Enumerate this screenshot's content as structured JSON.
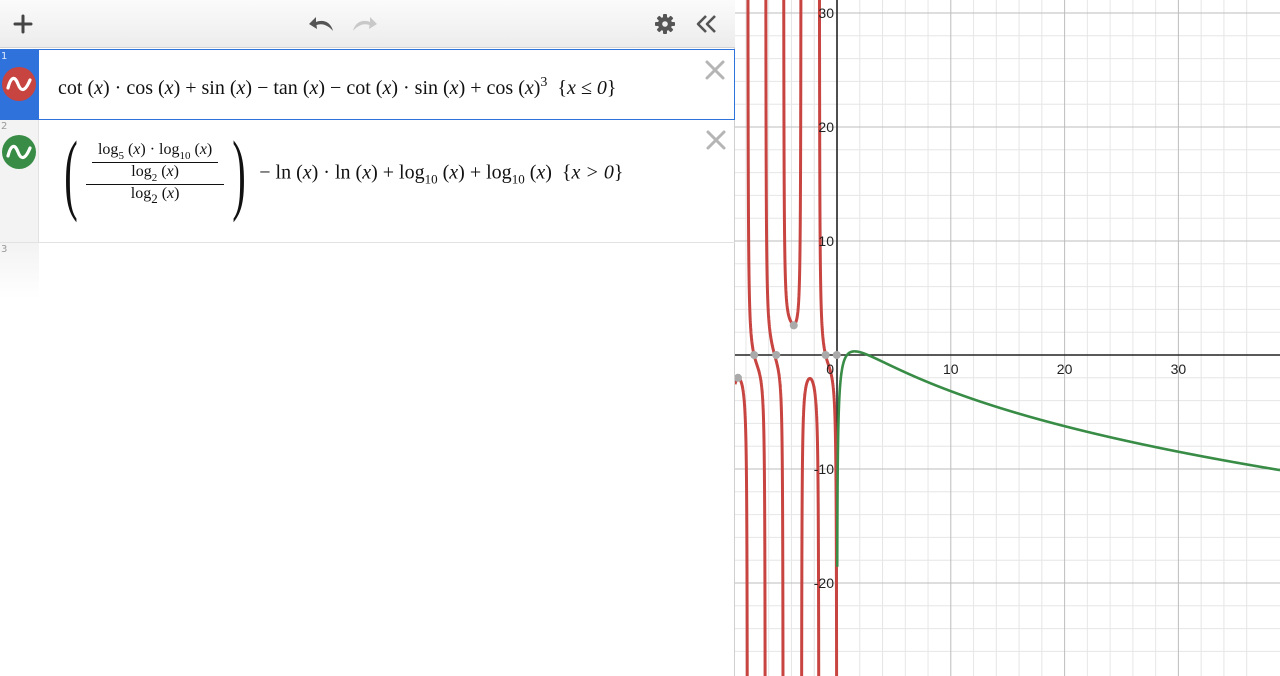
{
  "toolbar": {
    "add_icon": "plus-icon",
    "undo_icon": "undo-icon",
    "redo_icon": "redo-icon",
    "settings_icon": "gear-icon",
    "collapse_icon": "double-chevron-left-icon"
  },
  "expressions": [
    {
      "number": "1",
      "color": "#c74440",
      "selected": true,
      "latex_text": "cot (x) · cos (x) + sin (x) − tan (x) − cot (x) · sin (x) + cos (x)^3 {x ≤ 0}",
      "parts": {
        "cot1": "cot",
        "cos1": "cos",
        "sin1": "sin",
        "tan1": "tan",
        "cot2": "cot",
        "sin2": "sin",
        "cos2": "cos",
        "exp": "3",
        "cond": "x ≤ 0"
      }
    },
    {
      "number": "2",
      "color": "#388c46",
      "selected": false,
      "latex_text": "((log_5(x) · log_10(x) / log_2(x)) / log_2(x)) − ln (x) · ln (x) + log_10 (x) + log_10 (x) {x > 0}",
      "parts": {
        "log": "log",
        "ln": "ln",
        "b5": "5",
        "b10": "10",
        "b2": "2",
        "cond": "x > 0"
      }
    },
    {
      "number": "3"
    }
  ],
  "graph": {
    "x_range": [
      -10.3,
      37.6
    ],
    "y_range": [
      -27.7,
      31.5
    ],
    "x_ticks": [
      "10",
      "20",
      "30"
    ],
    "y_ticks": [
      "30",
      "20",
      "10",
      "-10",
      "-20"
    ],
    "origin_label": "0",
    "minor_step": 2,
    "major_step": 10,
    "curve1_color": "#c74440",
    "curve2_color": "#388c46"
  }
}
